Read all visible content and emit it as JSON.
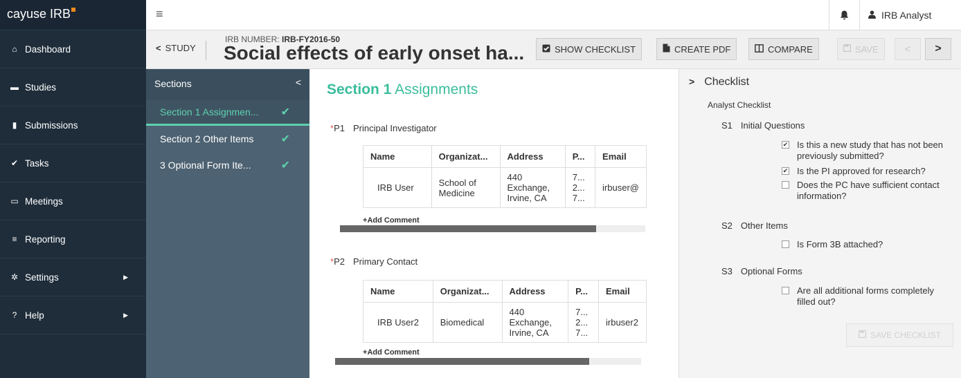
{
  "brand": {
    "name": "cayuse IRB"
  },
  "nav": [
    {
      "label": "Dashboard",
      "icon": "home-icon",
      "glyph": "⌂"
    },
    {
      "label": "Studies",
      "icon": "folder-icon",
      "glyph": "▬"
    },
    {
      "label": "Submissions",
      "icon": "file-icon",
      "glyph": "▮"
    },
    {
      "label": "Tasks",
      "icon": "check-icon",
      "glyph": "✔"
    },
    {
      "label": "Meetings",
      "icon": "calendar-icon",
      "glyph": "▭"
    },
    {
      "label": "Reporting",
      "icon": "list-icon",
      "glyph": "≡"
    },
    {
      "label": "Settings",
      "icon": "gear-icon",
      "glyph": "✲"
    },
    {
      "label": "Help",
      "icon": "question-icon",
      "glyph": "?"
    }
  ],
  "topbar": {
    "user": "IRB Analyst"
  },
  "study": {
    "back_label": "STUDY",
    "irb_label": "IRB NUMBER: ",
    "irb_number": "IRB-FY2016-50",
    "title": "Social effects of early onset ha..."
  },
  "toolbar": {
    "show_checklist": "SHOW CHECKLIST",
    "create_pdf": "CREATE PDF",
    "compare": "COMPARE",
    "save": "SAVE"
  },
  "sections": {
    "header": "Sections",
    "items": [
      {
        "label": "Section 1 Assignmen...",
        "active": true
      },
      {
        "label": "Section 2 Other Items",
        "active": false
      },
      {
        "label": "3 Optional Form Ite...",
        "active": false
      }
    ]
  },
  "main": {
    "section_num": "Section 1",
    "section_name": "Assignments",
    "add_comment": "Add Comment",
    "questions": [
      {
        "num": "P1",
        "label": "Principal Investigator",
        "columns": [
          "Name",
          "Organizat...",
          "Address",
          "P...",
          "Email"
        ],
        "row": {
          "name": "IRB User",
          "org": "School of Medicine",
          "address": "440 Exchange, Irvine, CA",
          "phone": "7... 2... 7...",
          "email": "irbuser@"
        },
        "scroll_fraction": 0.84
      },
      {
        "num": "P2",
        "label": "Primary Contact",
        "columns": [
          "Name",
          "Organizat...",
          "Address",
          "P...",
          "Email"
        ],
        "row": {
          "name": "IRB User2",
          "org": "Biomedical",
          "address": "440 Exchange, Irvine, CA",
          "phone": "7... 2... 7...",
          "email": "irbuser2"
        },
        "scroll_fraction": 0.83
      }
    ]
  },
  "checklist": {
    "title": "Checklist",
    "subtitle": "Analyst Checklist",
    "sections": [
      {
        "num": "S1",
        "label": "Initial Questions"
      },
      {
        "num": "S2",
        "label": "Other Items"
      },
      {
        "num": "S3",
        "label": "Optional Forms"
      }
    ],
    "items": [
      {
        "text": "Is this a new study that has not been previously submitted?",
        "checked": true
      },
      {
        "text": "Is the PI approved for research?",
        "checked": true
      },
      {
        "text": "Does the PC have sufficient contact information?",
        "checked": false
      },
      {
        "text": "Is Form 3B attached?",
        "checked": false
      },
      {
        "text": "Are all additional forms completely filled out?",
        "checked": false
      }
    ],
    "save_label": "SAVE CHECKLIST"
  },
  "colors": {
    "accent": "#3bbd9c",
    "nav_bg": "#1f2d3a",
    "sections_bg": "#4d6272",
    "brand_dot": "#f08a1c"
  }
}
